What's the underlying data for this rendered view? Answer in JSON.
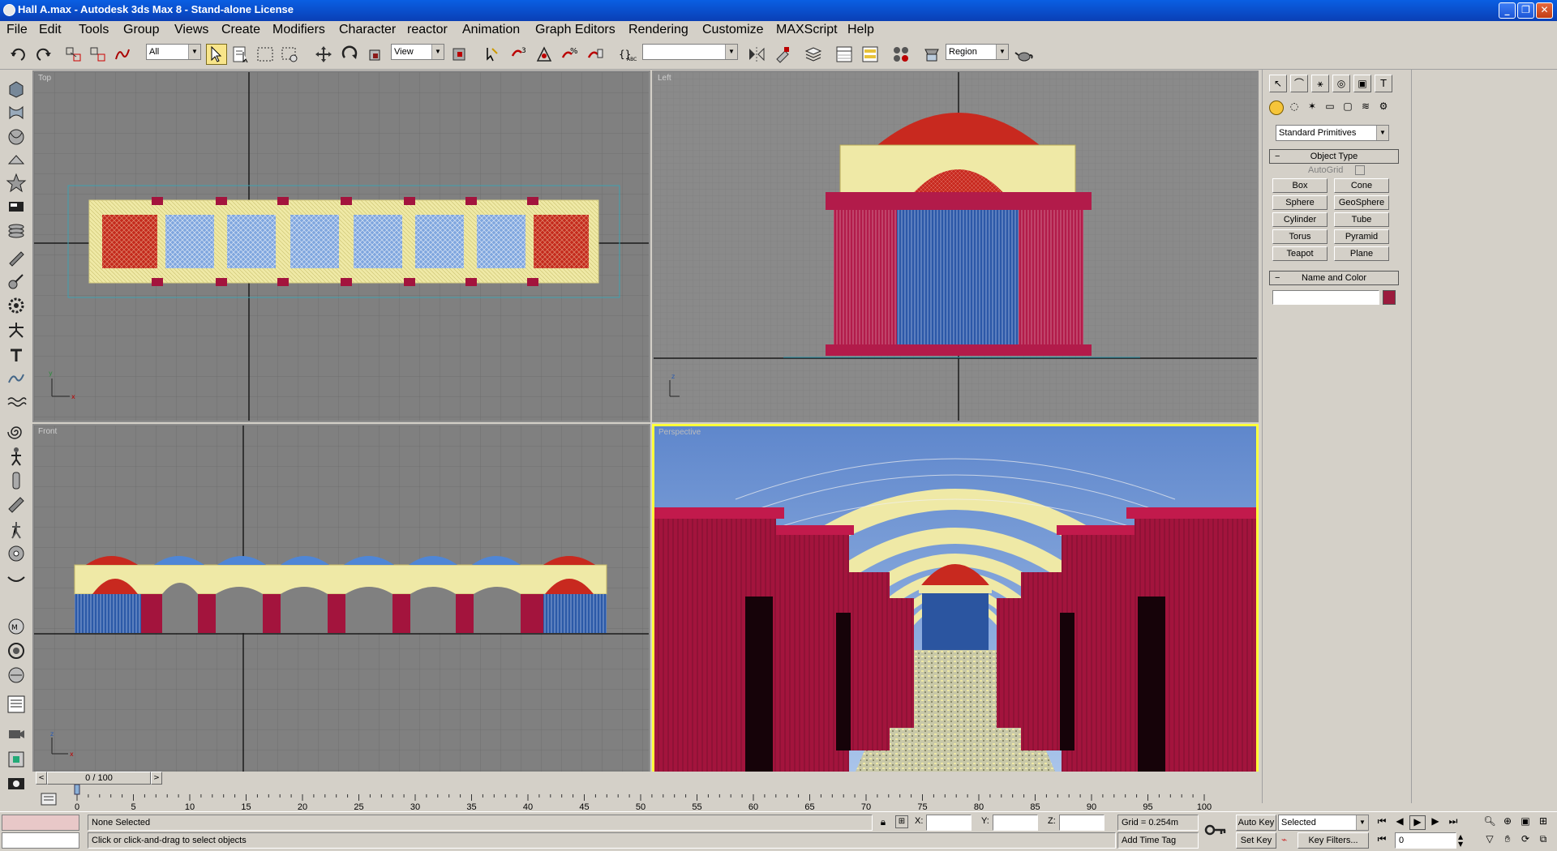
{
  "window": {
    "title": "Hall A.max - Autodesk 3ds Max 8 - Stand-alone License",
    "minimize": "_",
    "maximize": "❐",
    "close": "✕"
  },
  "menu": [
    "File",
    "Edit",
    "Tools",
    "Group",
    "Views",
    "Create",
    "Modifiers",
    "Character",
    "reactor",
    "Animation",
    "Graph Editors",
    "Rendering",
    "Customize",
    "MAXScript",
    "Help"
  ],
  "toolbar": {
    "selection_filter": "All",
    "reference_coord": "View",
    "named_selection": "",
    "render_type": "Region"
  },
  "viewports": {
    "top": "Top",
    "left": "Left",
    "front": "Front",
    "perspective": "Perspective"
  },
  "command_panel": {
    "category": "Standard Primitives",
    "object_type_title": "Object Type",
    "autogrid_label": "AutoGrid",
    "buttons": [
      "Box",
      "Cone",
      "Sphere",
      "GeoSphere",
      "Cylinder",
      "Tube",
      "Torus",
      "Pyramid",
      "Teapot",
      "Plane"
    ],
    "name_color_title": "Name and Color",
    "object_name": "",
    "object_color": "#9b1b3d"
  },
  "timeline": {
    "frame_display": "0 / 100",
    "ticks": [
      "0",
      "5",
      "10",
      "15",
      "20",
      "25",
      "30",
      "35",
      "40",
      "45",
      "50",
      "55",
      "60",
      "65",
      "70",
      "75",
      "80",
      "85",
      "90",
      "95",
      "100"
    ]
  },
  "status": {
    "selection": "None Selected",
    "prompt": "Click or click-and-drag to select objects",
    "x_label": "X:",
    "y_label": "Y:",
    "z_label": "Z:",
    "x_value": "",
    "y_value": "",
    "z_value": "",
    "grid": "Grid = 0.254m",
    "add_time_tag": "Add Time Tag",
    "auto_key": "Auto Key",
    "set_key": "Set Key",
    "key_mode": "Selected",
    "key_filters": "Key Filters...",
    "current_frame": "0"
  },
  "colors": {
    "maroon": "#a3143d",
    "cream": "#f2ecb0",
    "blue": "#3f77c8",
    "red": "#c81e1e",
    "viewport_bg": "#808080",
    "active_border": "#ffff3a"
  }
}
